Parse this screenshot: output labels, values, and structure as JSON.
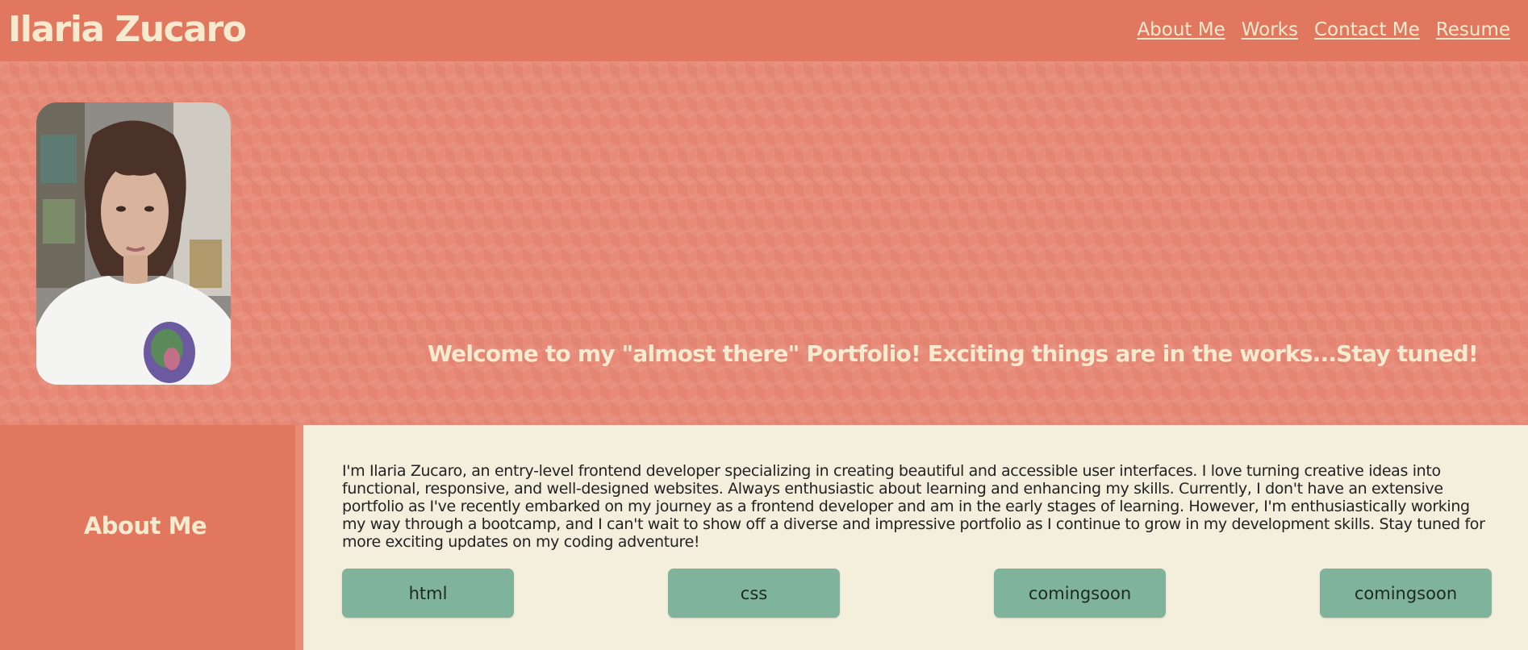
{
  "header": {
    "site_title": "Ilaria Zucaro",
    "nav": [
      "About Me",
      "Works",
      "Contact Me",
      "Resume"
    ]
  },
  "hero": {
    "welcome": "Welcome to my \"almost there\" Portfolio! Exciting things are in the works...Stay tuned!"
  },
  "about": {
    "heading": "About Me",
    "bio": "I'm Ilaria Zucaro, an entry-level frontend developer specializing in creating beautiful and accessible user interfaces. I love turning creative ideas into functional, responsive, and well-designed websites. Always enthusiastic about learning and enhancing my skills. Currently, I don't have an extensive portfolio as I've recently embarked on my journey as a frontend developer and am in the early stages of learning. However, I'm enthusiastically working my way through a bootcamp, and I can't wait to show off a diverse and impressive portfolio as I continue to grow in my development skills. Stay tuned for more exciting updates on my coding adventure!",
    "skills": [
      "html",
      "css",
      "comingsoon",
      "comingsoon"
    ]
  },
  "colors": {
    "primary": "#e0775e",
    "cream": "#f3efdc",
    "text_light": "#f6ebcf",
    "skill_green": "#80b39b"
  }
}
